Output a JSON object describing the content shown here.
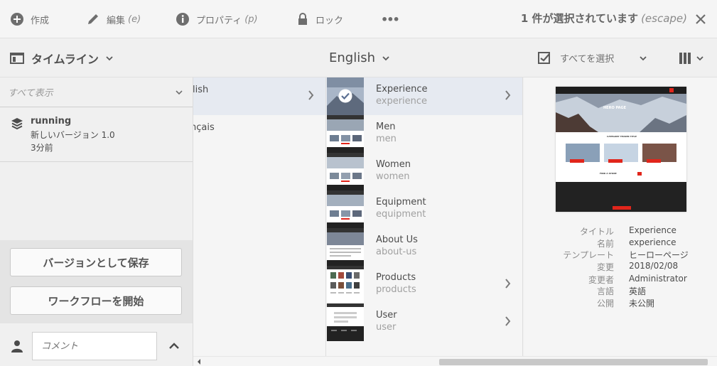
{
  "toolbar": {
    "create": {
      "label": "作成"
    },
    "edit": {
      "label": "編集",
      "shortcut": "(e)"
    },
    "properties": {
      "label": "プロパティ",
      "shortcut": "(p)"
    },
    "lock": {
      "label": "ロック"
    },
    "more": {
      "label": "•••"
    },
    "selection": {
      "text": "1 件が選択されています",
      "shortcut": "(escape)"
    }
  },
  "subbar": {
    "rail_title": "タイムライン",
    "breadcrumb": "English",
    "select_all": "すべてを選択"
  },
  "rail": {
    "filter_placeholder": "すべて表示",
    "version": {
      "name": "running",
      "desc": "新しいバージョン 1.0",
      "time": "3分前"
    },
    "save_version_label": "バージョンとして保存",
    "start_workflow_label": "ワークフローを開始",
    "comment_placeholder": "コメント"
  },
  "column1": [
    {
      "label": "lish",
      "selected": true,
      "has_children": true
    },
    {
      "label": "nçais",
      "selected": false,
      "has_children": false
    }
  ],
  "column2": [
    {
      "title": "Experience",
      "name": "experience",
      "selected": true,
      "has_children": true
    },
    {
      "title": "Men",
      "name": "men",
      "selected": false,
      "has_children": false
    },
    {
      "title": "Women",
      "name": "women",
      "selected": false,
      "has_children": false
    },
    {
      "title": "Equipment",
      "name": "equipment",
      "selected": false,
      "has_children": false
    },
    {
      "title": "About Us",
      "name": "about-us",
      "selected": false,
      "has_children": false
    },
    {
      "title": "Products",
      "name": "products",
      "selected": false,
      "has_children": true
    },
    {
      "title": "User",
      "name": "user",
      "selected": false,
      "has_children": true
    }
  ],
  "preview": {
    "hero_text": "HERO PAGE",
    "teaser_title": "CATEGORY TEASER TITLE",
    "store_text": "FIND A STORE"
  },
  "properties": [
    {
      "label": "タイトル",
      "value": "Experience"
    },
    {
      "label": "名前",
      "value": "experience"
    },
    {
      "label": "テンプレート",
      "value": "ヒーローページ"
    },
    {
      "label": "変更",
      "value": "2018/02/08"
    },
    {
      "label": "変更者",
      "value": "Administrator"
    },
    {
      "label": "言語",
      "value": "英語"
    },
    {
      "label": "公開",
      "value": "未公開"
    }
  ],
  "colors": {
    "selected_row": "#e6eaf1",
    "accent_red": "#e1251b",
    "dark_footer": "#222222"
  }
}
